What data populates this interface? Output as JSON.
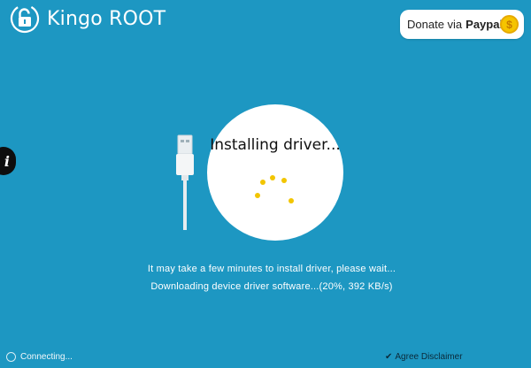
{
  "app": {
    "title": "Kingo ROOT"
  },
  "header": {
    "donate_prefix": "Donate via",
    "donate_brand": "Paypal",
    "coin_symbol": "$"
  },
  "info_button": {
    "label": "i"
  },
  "main": {
    "status_title": "Installing driver...",
    "message": "It may take a few minutes to install driver, please wait...",
    "progress_text": "Downloading device driver software...(20%, 392 KB/s)",
    "progress_percent": 20,
    "speed": "392 KB/s"
  },
  "footer": {
    "connection_status": "Connecting...",
    "disclaimer_label": "Agree Disclaimer"
  },
  "colors": {
    "background": "#1d97c2",
    "accent_dot": "#f2c500",
    "coin": "#f5c400"
  }
}
